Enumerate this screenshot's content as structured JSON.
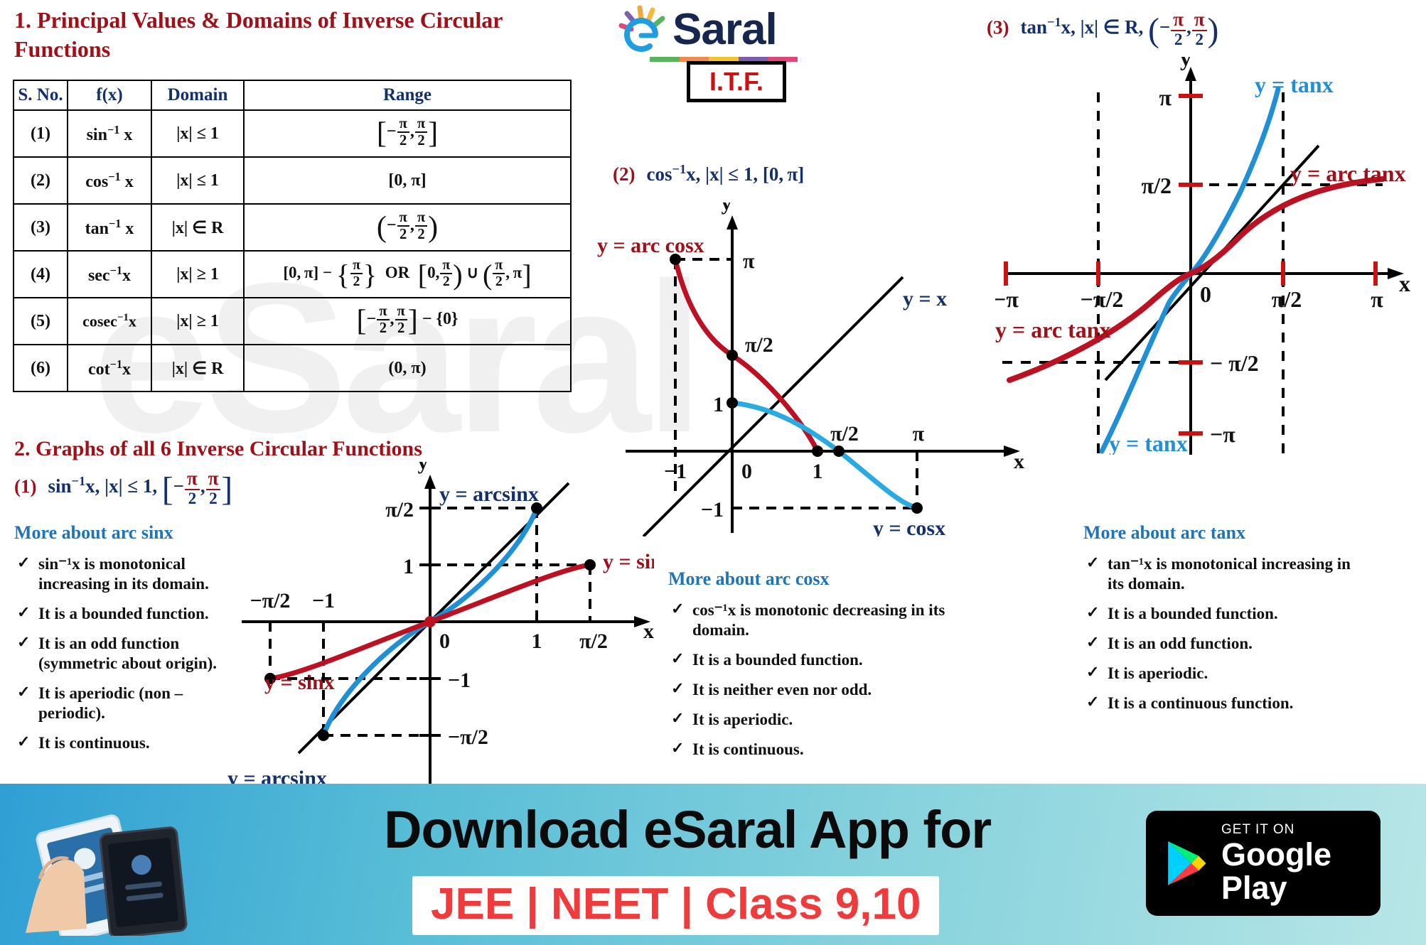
{
  "watermark_text": "eSaral",
  "brand": {
    "logo_e": "e",
    "logo_text": "Saral",
    "badge_label": "I.T.F.",
    "bar_colors": [
      "#56b45b",
      "#f08a4b",
      "#f2c32e",
      "#7a5fb0",
      "#e0457b"
    ],
    "ray_colors": [
      "#e0457b",
      "#7a5fb0",
      "#f2a93b",
      "#f6b93b",
      "#56b45b"
    ],
    "navy": "#16264f",
    "e_blue": "#1f9de0"
  },
  "section1": {
    "title": "1. Principal Values & Domains of Inverse Circular Functions",
    "table": {
      "headers": [
        "S. No.",
        "f(x)",
        "Domain",
        "Range"
      ],
      "rows": [
        {
          "sno": "(1)",
          "fx": "sin",
          "inv": "-1",
          "arg": " x",
          "domain": "|x| ≤ 1",
          "range_kind": "frac_bracket",
          "range_text": "[−π/2, π/2]"
        },
        {
          "sno": "(2)",
          "fx": "cos",
          "inv": "-1",
          "arg": " x",
          "domain": "|x| ≤ 1",
          "range_kind": "plain",
          "range_text": "[0, π]"
        },
        {
          "sno": "(3)",
          "fx": "tan",
          "inv": "-1",
          "arg": " x",
          "domain": "|x| ∈ R",
          "range_kind": "frac_paren",
          "range_text": "(−π/2, π/2)"
        },
        {
          "sno": "(4)",
          "fx": "sec",
          "inv": "-1",
          "arg": "x",
          "domain": "|x| ≥ 1",
          "range_kind": "sec",
          "range_text": "[0, π] − {π/2}  OR  [0, π/2) ∪ (π/2, π]"
        },
        {
          "sno": "(5)",
          "fx": "cosec",
          "inv": "-1",
          "arg": "x",
          "domain": "|x| ≥ 1",
          "range_kind": "cosec",
          "range_text": "[−π/2, π/2] − {0}"
        },
        {
          "sno": "(6)",
          "fx": "cot",
          "inv": "-1",
          "arg": "x",
          "domain": "|x| ∈ R",
          "range_kind": "plain",
          "range_text": "(0, π)"
        }
      ]
    }
  },
  "section2": {
    "title": "2. Graphs of all 6 Inverse Circular Functions",
    "items": [
      {
        "num": "(1)",
        "func": "sin",
        "inv": "-1",
        "tail": "x, |x| ≤ 1,",
        "interval": "[−π/2, π/2]"
      },
      {
        "num": "(2)",
        "func": "cos",
        "inv": "-1",
        "tail": "x, |x| ≤ 1, [0, π]",
        "interval": ""
      },
      {
        "num": "(3)",
        "func": "tan",
        "inv": "-1",
        "tail": "x, |x| ∈ R,",
        "interval": "(−π/2, π/2)"
      }
    ]
  },
  "arcsin": {
    "more_title": "More about arc sinx",
    "facts": [
      "sin⁻¹x is monotonical increasing in its domain.",
      "It is a bounded function.",
      "It is an odd function (symmetric about origin).",
      "It is aperiodic (non – periodic).",
      "It is continuous."
    ],
    "curve_labels": {
      "arcsin_top": "y = arcsinx",
      "sinx_right": "y = sinx",
      "sinx_left": "y = sinx",
      "arcsin_bottom": "y = arcsinx"
    },
    "axis": {
      "y": "y",
      "x": "x",
      "origin": "0",
      "y_ticks": [
        "π/2",
        "1",
        "−1",
        "−π/2"
      ],
      "x_ticks": [
        "−π/2",
        "−1",
        "1",
        "π/2"
      ]
    },
    "colors": {
      "arcsin": "#1f8fd6",
      "sinx": "#bb1122",
      "identity": "#000000"
    }
  },
  "arccos": {
    "more_title": "More about arc cosx",
    "facts": [
      "cos⁻¹x is monotonic decreasing in its domain.",
      "It is a bounded function.",
      "It is neither even nor odd.",
      "It is aperiodic.",
      "It is continuous."
    ],
    "curve_labels": {
      "arccos": "y = arc cosx",
      "cosx": "y = cosx",
      "identity": "y = x"
    },
    "axis": {
      "y": "y",
      "x": "x",
      "origin": "0",
      "y_ticks": [
        "π",
        "π/2",
        "1",
        "−1"
      ],
      "x_ticks": [
        "−1",
        "1",
        "π/2",
        "π"
      ]
    },
    "colors": {
      "arccos": "#bb1122",
      "cosx": "#29abe2",
      "identity": "#000000"
    }
  },
  "arctan": {
    "more_title": "More about arc tanx",
    "facts": [
      "tan⁻¹x is monotonical increasing in its domain.",
      "It is a bounded function.",
      "It is an odd function.",
      "It is aperiodic.",
      "It is a continuous function."
    ],
    "curve_labels": {
      "tanx_top": "y = tanx",
      "arctan_right": "y = arc tanx",
      "arctan_left": "y = arc tanx",
      "tanx_bottom": "y = tanx"
    },
    "axis": {
      "y": "y",
      "x": "x",
      "origin": "0",
      "y_ticks": [
        "π",
        "π/2",
        "− π/2",
        "−π"
      ],
      "x_ticks": [
        "−π",
        "−π/2",
        "π/2",
        "π"
      ]
    },
    "colors": {
      "arctan": "#bb1122",
      "tanx": "#1f8fd6",
      "identity": "#000000",
      "tick": "#cc1111"
    }
  },
  "banner": {
    "line1": "Download eSaral App for",
    "line2": "JEE | NEET | Class 9,10",
    "store_small": "GET IT ON",
    "store_big": "Google Play"
  }
}
